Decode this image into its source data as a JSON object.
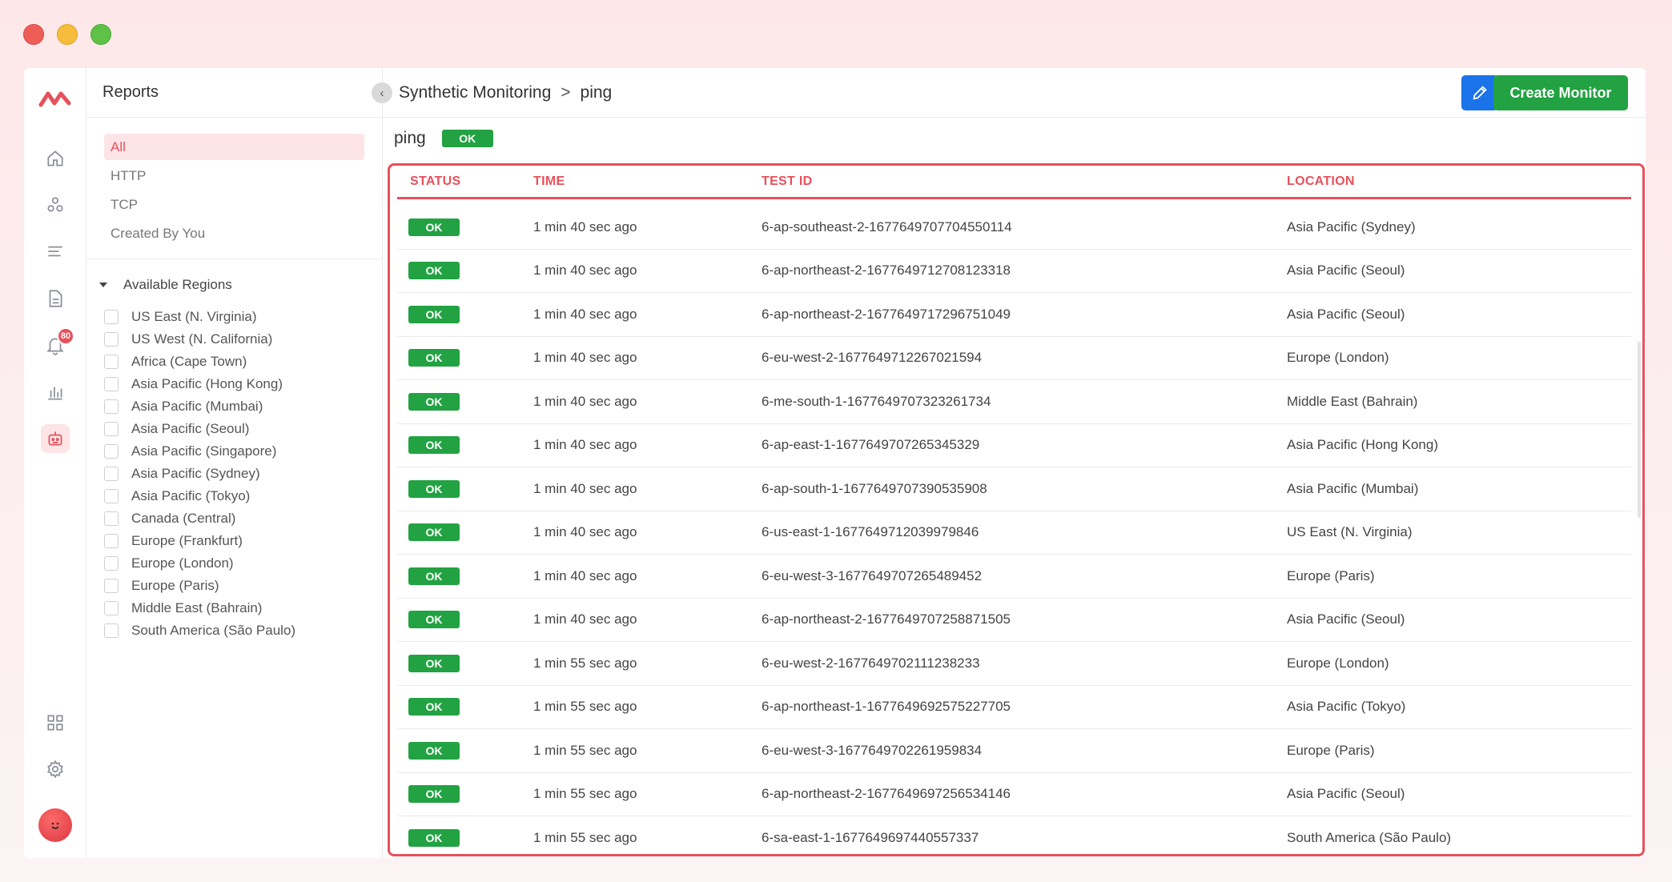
{
  "sidebar_rail": {
    "notification_count": "80",
    "icons": [
      "home-icon",
      "services-icon",
      "logs-icon",
      "document-icon",
      "bell-icon",
      "bar-chart-icon",
      "robot-icon",
      "grid-icon",
      "gear-icon"
    ]
  },
  "reports": {
    "title": "Reports",
    "filters": [
      {
        "label": "All",
        "active": true
      },
      {
        "label": "HTTP",
        "active": false
      },
      {
        "label": "TCP",
        "active": false
      },
      {
        "label": "Created By You",
        "active": false
      }
    ],
    "regions_title": "Available Regions",
    "regions": [
      "US East (N. Virginia)",
      "US West (N. California)",
      "Africa (Cape Town)",
      "Asia Pacific (Hong Kong)",
      "Asia Pacific (Mumbai)",
      "Asia Pacific (Seoul)",
      "Asia Pacific (Singapore)",
      "Asia Pacific (Sydney)",
      "Asia Pacific (Tokyo)",
      "Canada (Central)",
      "Europe (Frankfurt)",
      "Europe (London)",
      "Europe (Paris)",
      "Middle East (Bahrain)",
      "South America (São Paulo)"
    ]
  },
  "header": {
    "breadcrumb_root": "Synthetic Monitoring",
    "breadcrumb_sep": ">",
    "breadcrumb_current": "ping",
    "create_label": "Create Monitor"
  },
  "monitor": {
    "name": "ping",
    "status": "OK"
  },
  "table": {
    "headers": {
      "status": "STATUS",
      "time": "TIME",
      "test_id": "TEST ID",
      "location": "LOCATION"
    },
    "rows": [
      {
        "status": "OK",
        "time": "1 min 40 sec ago",
        "test_id": "6-ap-southeast-2-1677649707704550114",
        "location": "Asia Pacific (Sydney)"
      },
      {
        "status": "OK",
        "time": "1 min 40 sec ago",
        "test_id": "6-ap-northeast-2-1677649712708123318",
        "location": "Asia Pacific (Seoul)"
      },
      {
        "status": "OK",
        "time": "1 min 40 sec ago",
        "test_id": "6-ap-northeast-2-1677649717296751049",
        "location": "Asia Pacific (Seoul)"
      },
      {
        "status": "OK",
        "time": "1 min 40 sec ago",
        "test_id": "6-eu-west-2-1677649712267021594",
        "location": "Europe (London)"
      },
      {
        "status": "OK",
        "time": "1 min 40 sec ago",
        "test_id": "6-me-south-1-1677649707323261734",
        "location": "Middle East (Bahrain)"
      },
      {
        "status": "OK",
        "time": "1 min 40 sec ago",
        "test_id": "6-ap-east-1-1677649707265345329",
        "location": "Asia Pacific (Hong Kong)"
      },
      {
        "status": "OK",
        "time": "1 min 40 sec ago",
        "test_id": "6-ap-south-1-1677649707390535908",
        "location": "Asia Pacific (Mumbai)"
      },
      {
        "status": "OK",
        "time": "1 min 40 sec ago",
        "test_id": "6-us-east-1-1677649712039979846",
        "location": "US East (N. Virginia)"
      },
      {
        "status": "OK",
        "time": "1 min 40 sec ago",
        "test_id": "6-eu-west-3-1677649707265489452",
        "location": "Europe (Paris)"
      },
      {
        "status": "OK",
        "time": "1 min 40 sec ago",
        "test_id": "6-ap-northeast-2-1677649707258871505",
        "location": "Asia Pacific (Seoul)"
      },
      {
        "status": "OK",
        "time": "1 min 55 sec ago",
        "test_id": "6-eu-west-2-1677649702111238233",
        "location": "Europe (London)"
      },
      {
        "status": "OK",
        "time": "1 min 55 sec ago",
        "test_id": "6-ap-northeast-1-1677649692575227705",
        "location": "Asia Pacific (Tokyo)"
      },
      {
        "status": "OK",
        "time": "1 min 55 sec ago",
        "test_id": "6-eu-west-3-1677649702261959834",
        "location": "Europe (Paris)"
      },
      {
        "status": "OK",
        "time": "1 min 55 sec ago",
        "test_id": "6-ap-northeast-2-1677649697256534146",
        "location": "Asia Pacific (Seoul)"
      },
      {
        "status": "OK",
        "time": "1 min 55 sec ago",
        "test_id": "6-sa-east-1-1677649697440557337",
        "location": "South America (São Paulo)"
      }
    ]
  },
  "colors": {
    "accent": "#e8505b",
    "ok_green": "#22a242",
    "edit_blue": "#1a73e8"
  }
}
